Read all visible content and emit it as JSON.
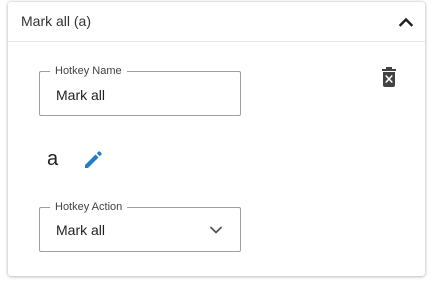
{
  "hotkey": {
    "header_title": "Mark all (a)",
    "name_legend": "Hotkey Name",
    "name_value": "Mark all",
    "key": "a",
    "action_legend": "Hotkey Action",
    "action_value": "Mark all"
  },
  "icons": {
    "collapse": "chevron-up-icon",
    "delete": "trash-x-icon",
    "edit": "pencil-icon",
    "dropdown": "chevron-down-icon"
  },
  "colors": {
    "accent": "#1e7fc6",
    "icon_dark": "#424242",
    "border": "#9e9e9e"
  }
}
